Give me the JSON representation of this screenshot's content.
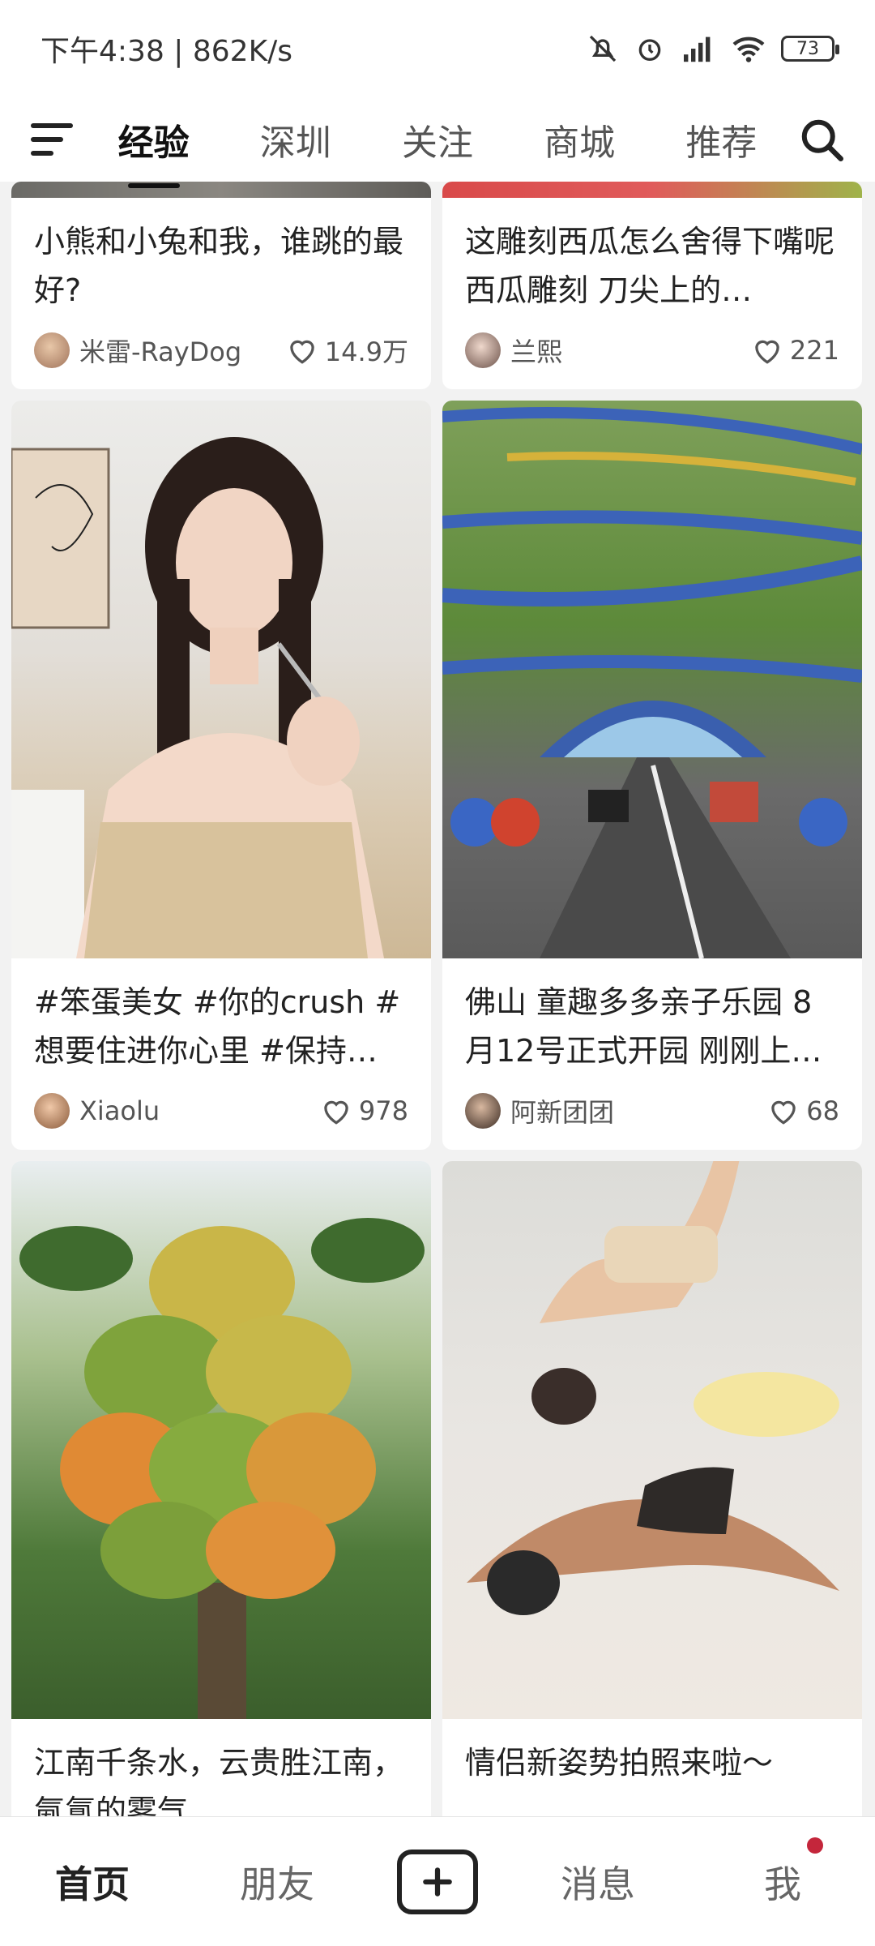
{
  "status_bar": {
    "time_speed": "下午4:38 | 862K/s",
    "battery": "73"
  },
  "top_nav": {
    "tabs": [
      {
        "label": "经验",
        "active": true
      },
      {
        "label": "深圳",
        "active": false
      },
      {
        "label": "关注",
        "active": false
      },
      {
        "label": "商城",
        "active": false
      },
      {
        "label": "推荐",
        "active": false
      }
    ],
    "menu_icon": "menu-icon",
    "search_icon": "search-icon"
  },
  "feed": {
    "left": [
      {
        "title": "小熊和小兔和我，谁跳的最好?",
        "author": "米雷-RayDog",
        "likes": "14.9万"
      },
      {
        "title": "#笨蛋美女 #你的crush #想要住进你心里 #保持…",
        "author": "Xiaolu",
        "likes": "978"
      },
      {
        "title": "江南千条水，云贵胜江南，氤氲的雾气",
        "author": "",
        "likes": ""
      }
    ],
    "right": [
      {
        "title": "这雕刻西瓜怎么舍得下嘴呢 西瓜雕刻 刀尖上的…",
        "author": "兰熙",
        "likes": "221"
      },
      {
        "title": "佛山 童趣多多亲子乐园 8月12号正式开园 刚刚上…",
        "author": "阿新团团",
        "likes": "68"
      },
      {
        "title": "情侣新姿势拍照来啦～",
        "author": "",
        "likes": ""
      }
    ]
  },
  "bottom_nav": {
    "home": "首页",
    "friends": "朋友",
    "messages": "消息",
    "me": "我"
  },
  "colors": {
    "accent": "#111111",
    "notification_dot": "#c4263b",
    "background": "#f2f2f2"
  }
}
